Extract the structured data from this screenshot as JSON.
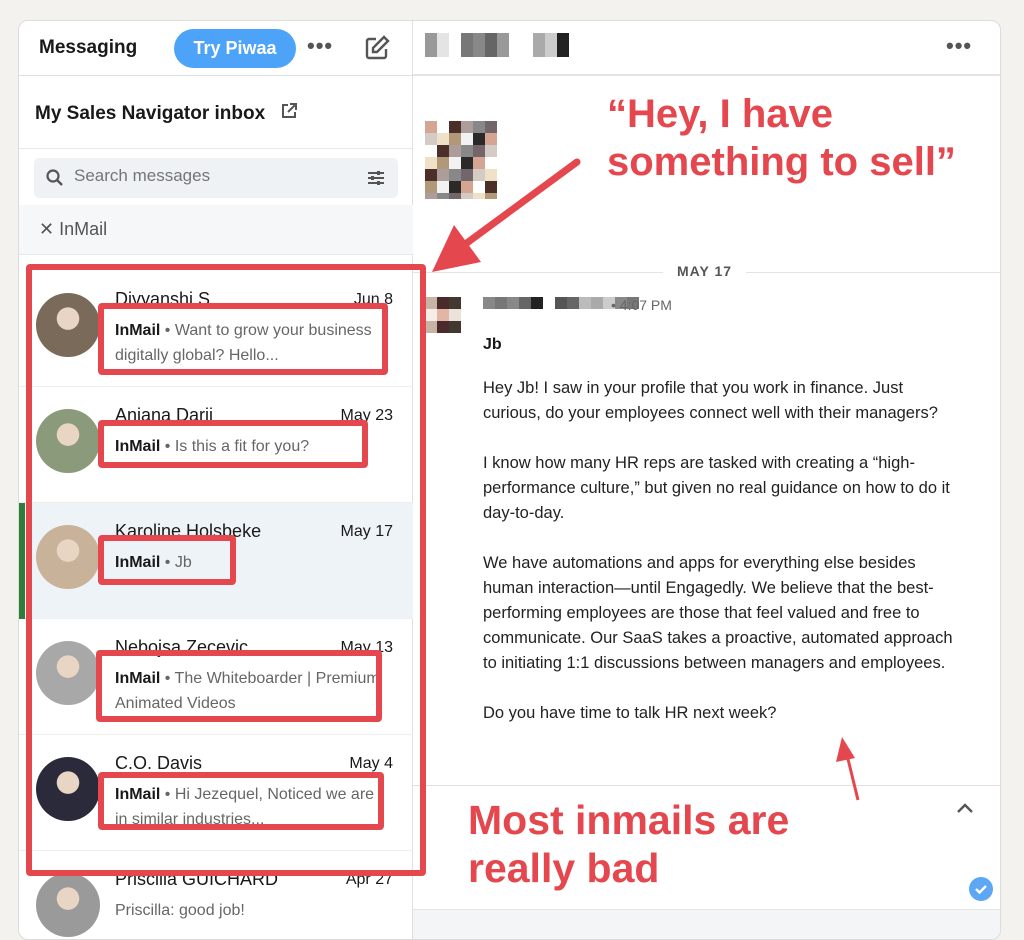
{
  "sidebar": {
    "title": "Messaging",
    "try_button": "Try Piwaa",
    "more_label": "•••",
    "inbox_title": "My Sales Navigator inbox",
    "search_placeholder": "Search messages",
    "filter_chip": "InMail",
    "conversations": [
      {
        "name": "Divyanshi S",
        "date": "Jun 8",
        "tag": "InMail",
        "preview": "Want to grow your business digitally global? Hello...",
        "selected": false
      },
      {
        "name": "Anjana Darji",
        "date": "May 23",
        "tag": "InMail",
        "preview": "Is this a fit for you?",
        "selected": false
      },
      {
        "name": "Karoline Holsbeke",
        "date": "May 17",
        "tag": "InMail",
        "preview": "Jb",
        "selected": true
      },
      {
        "name": "Nebojsa Zecevic",
        "date": "May 13",
        "tag": "InMail",
        "preview": "The Whiteboarder | Premium Animated Videos",
        "selected": false
      },
      {
        "name": "C.O. Davis",
        "date": "May 4",
        "tag": "InMail",
        "preview": "Hi Jezequel, Noticed we are in similar industries...",
        "selected": false
      },
      {
        "name": "Priscilla GUICHARD",
        "date": "Apr 27",
        "tag": "",
        "preview": "Priscilla: good job!",
        "selected": false
      }
    ]
  },
  "conversation": {
    "more_label": "•••",
    "date_divider": "MAY 17",
    "time": "• 4:07 PM",
    "subject": "Jb",
    "paragraphs": [
      "Hey Jb! I saw in your profile that you work in finance. Just curious, do your employees connect well with their managers?",
      "I know how many HR reps are tasked with creating a “high-performance culture,” but given no real guidance on how to do it day-to-day.",
      "We have automations and apps for everything else besides human interaction—until Engagedly. We believe that the best-performing employees are those that feel valued and free to communicate. Our SaaS takes a proactive, automated approach to initiating 1:1 discussions between managers and employees.",
      "Do you have time to talk HR next week?"
    ]
  },
  "annotations": {
    "top_line1": "“Hey, I have",
    "top_line2": "something to sell”",
    "bottom_line1": "Most inmails are",
    "bottom_line2": "really bad"
  },
  "colors": {
    "accent": "#4da3f7",
    "annotation": "#e5474e",
    "selected_bar": "#2e7d3a"
  }
}
